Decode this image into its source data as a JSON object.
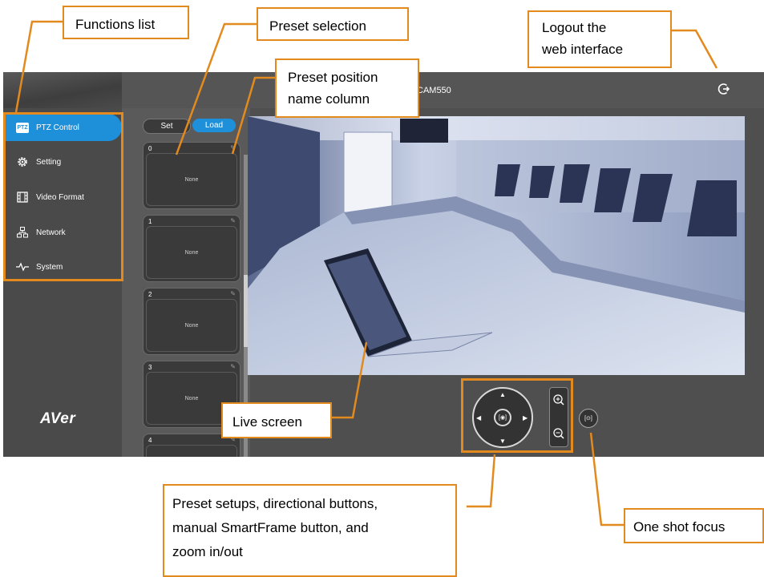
{
  "app": {
    "camera_name": "CAM550",
    "logo": "AVer",
    "sidebar": {
      "items": [
        {
          "label": "PTZ Control",
          "icon": "ptz-icon",
          "badge": "PTZ",
          "active": true
        },
        {
          "label": "Setting",
          "icon": "gear-icon"
        },
        {
          "label": "Video Format",
          "icon": "film-icon"
        },
        {
          "label": "Network",
          "icon": "network-icon"
        },
        {
          "label": "System",
          "icon": "pulse-icon"
        }
      ]
    },
    "preset": {
      "set_label": "Set",
      "load_label": "Load",
      "cards": [
        {
          "number": "0",
          "name": "None"
        },
        {
          "number": "1",
          "name": "None"
        },
        {
          "number": "2",
          "name": "None"
        },
        {
          "number": "3",
          "name": "None"
        },
        {
          "number": "4",
          "name": ""
        }
      ]
    },
    "controls": {
      "smartframe_glyph": "[◉]",
      "oneshot_glyph": "[⊙]"
    },
    "colors": {
      "accent": "#1e8fd9",
      "annotation": "#e38a1e",
      "panel": "#4f4f4f"
    }
  },
  "annotations": {
    "functions_list": "Functions list",
    "preset_selection": "Preset selection",
    "preset_name_column": [
      "Preset position",
      "name column"
    ],
    "logout": [
      "Logout the",
      "web interface"
    ],
    "live_screen": "Live screen",
    "controls": [
      "Preset setups, directional buttons,",
      "manual SmartFrame button, and",
      "zoom in/out"
    ],
    "one_shot_focus": "One shot focus"
  }
}
